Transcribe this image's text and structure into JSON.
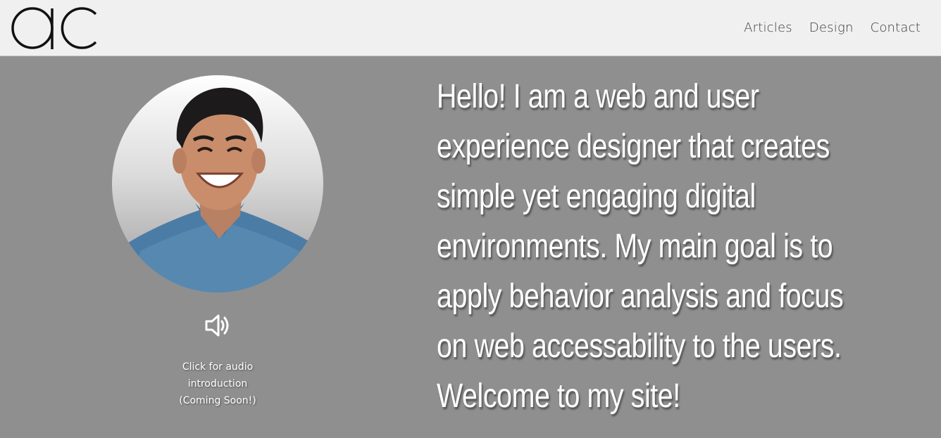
{
  "header": {
    "logo_text": "ac",
    "nav": [
      {
        "label": "Articles"
      },
      {
        "label": "Design"
      },
      {
        "label": "Contact"
      }
    ]
  },
  "hero": {
    "portrait_icon": "person-portrait",
    "audio_icon": "speaker-icon",
    "audio_caption": "Click for audio\nintroduction\n(Coming Soon!)",
    "intro_lines": [
      "Hello! I am a web and user",
      "experience designer that creates",
      "simple yet engaging digital",
      "environments. My main goal is to",
      "apply behavior analysis and focus",
      "on web accessability to the users.",
      "Welcome to my site!"
    ]
  },
  "colors": {
    "header_bg": "#f0f0f0",
    "page_bg": "#8f8f8f",
    "text": "#ffffff",
    "nav_text": "#3a3a3a"
  }
}
